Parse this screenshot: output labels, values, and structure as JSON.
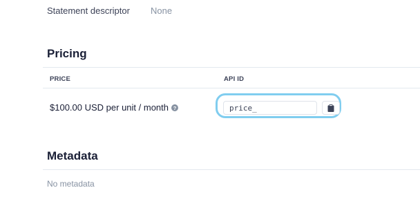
{
  "details": {
    "statement_descriptor_label": "Statement descriptor",
    "statement_descriptor_value": "None"
  },
  "pricing": {
    "title": "Pricing",
    "columns": {
      "price": "PRICE",
      "api_id": "API ID"
    },
    "rows": [
      {
        "price": "$100.00 USD per unit / month",
        "api_id_value": "price_"
      }
    ]
  },
  "metadata": {
    "title": "Metadata",
    "empty_text": "No metadata"
  },
  "icons": {
    "help": "question-circle-icon",
    "copy": "clipboard-icon"
  },
  "colors": {
    "highlight": "#80cdef",
    "muted": "#8792a2",
    "heading": "#1a1f36"
  }
}
